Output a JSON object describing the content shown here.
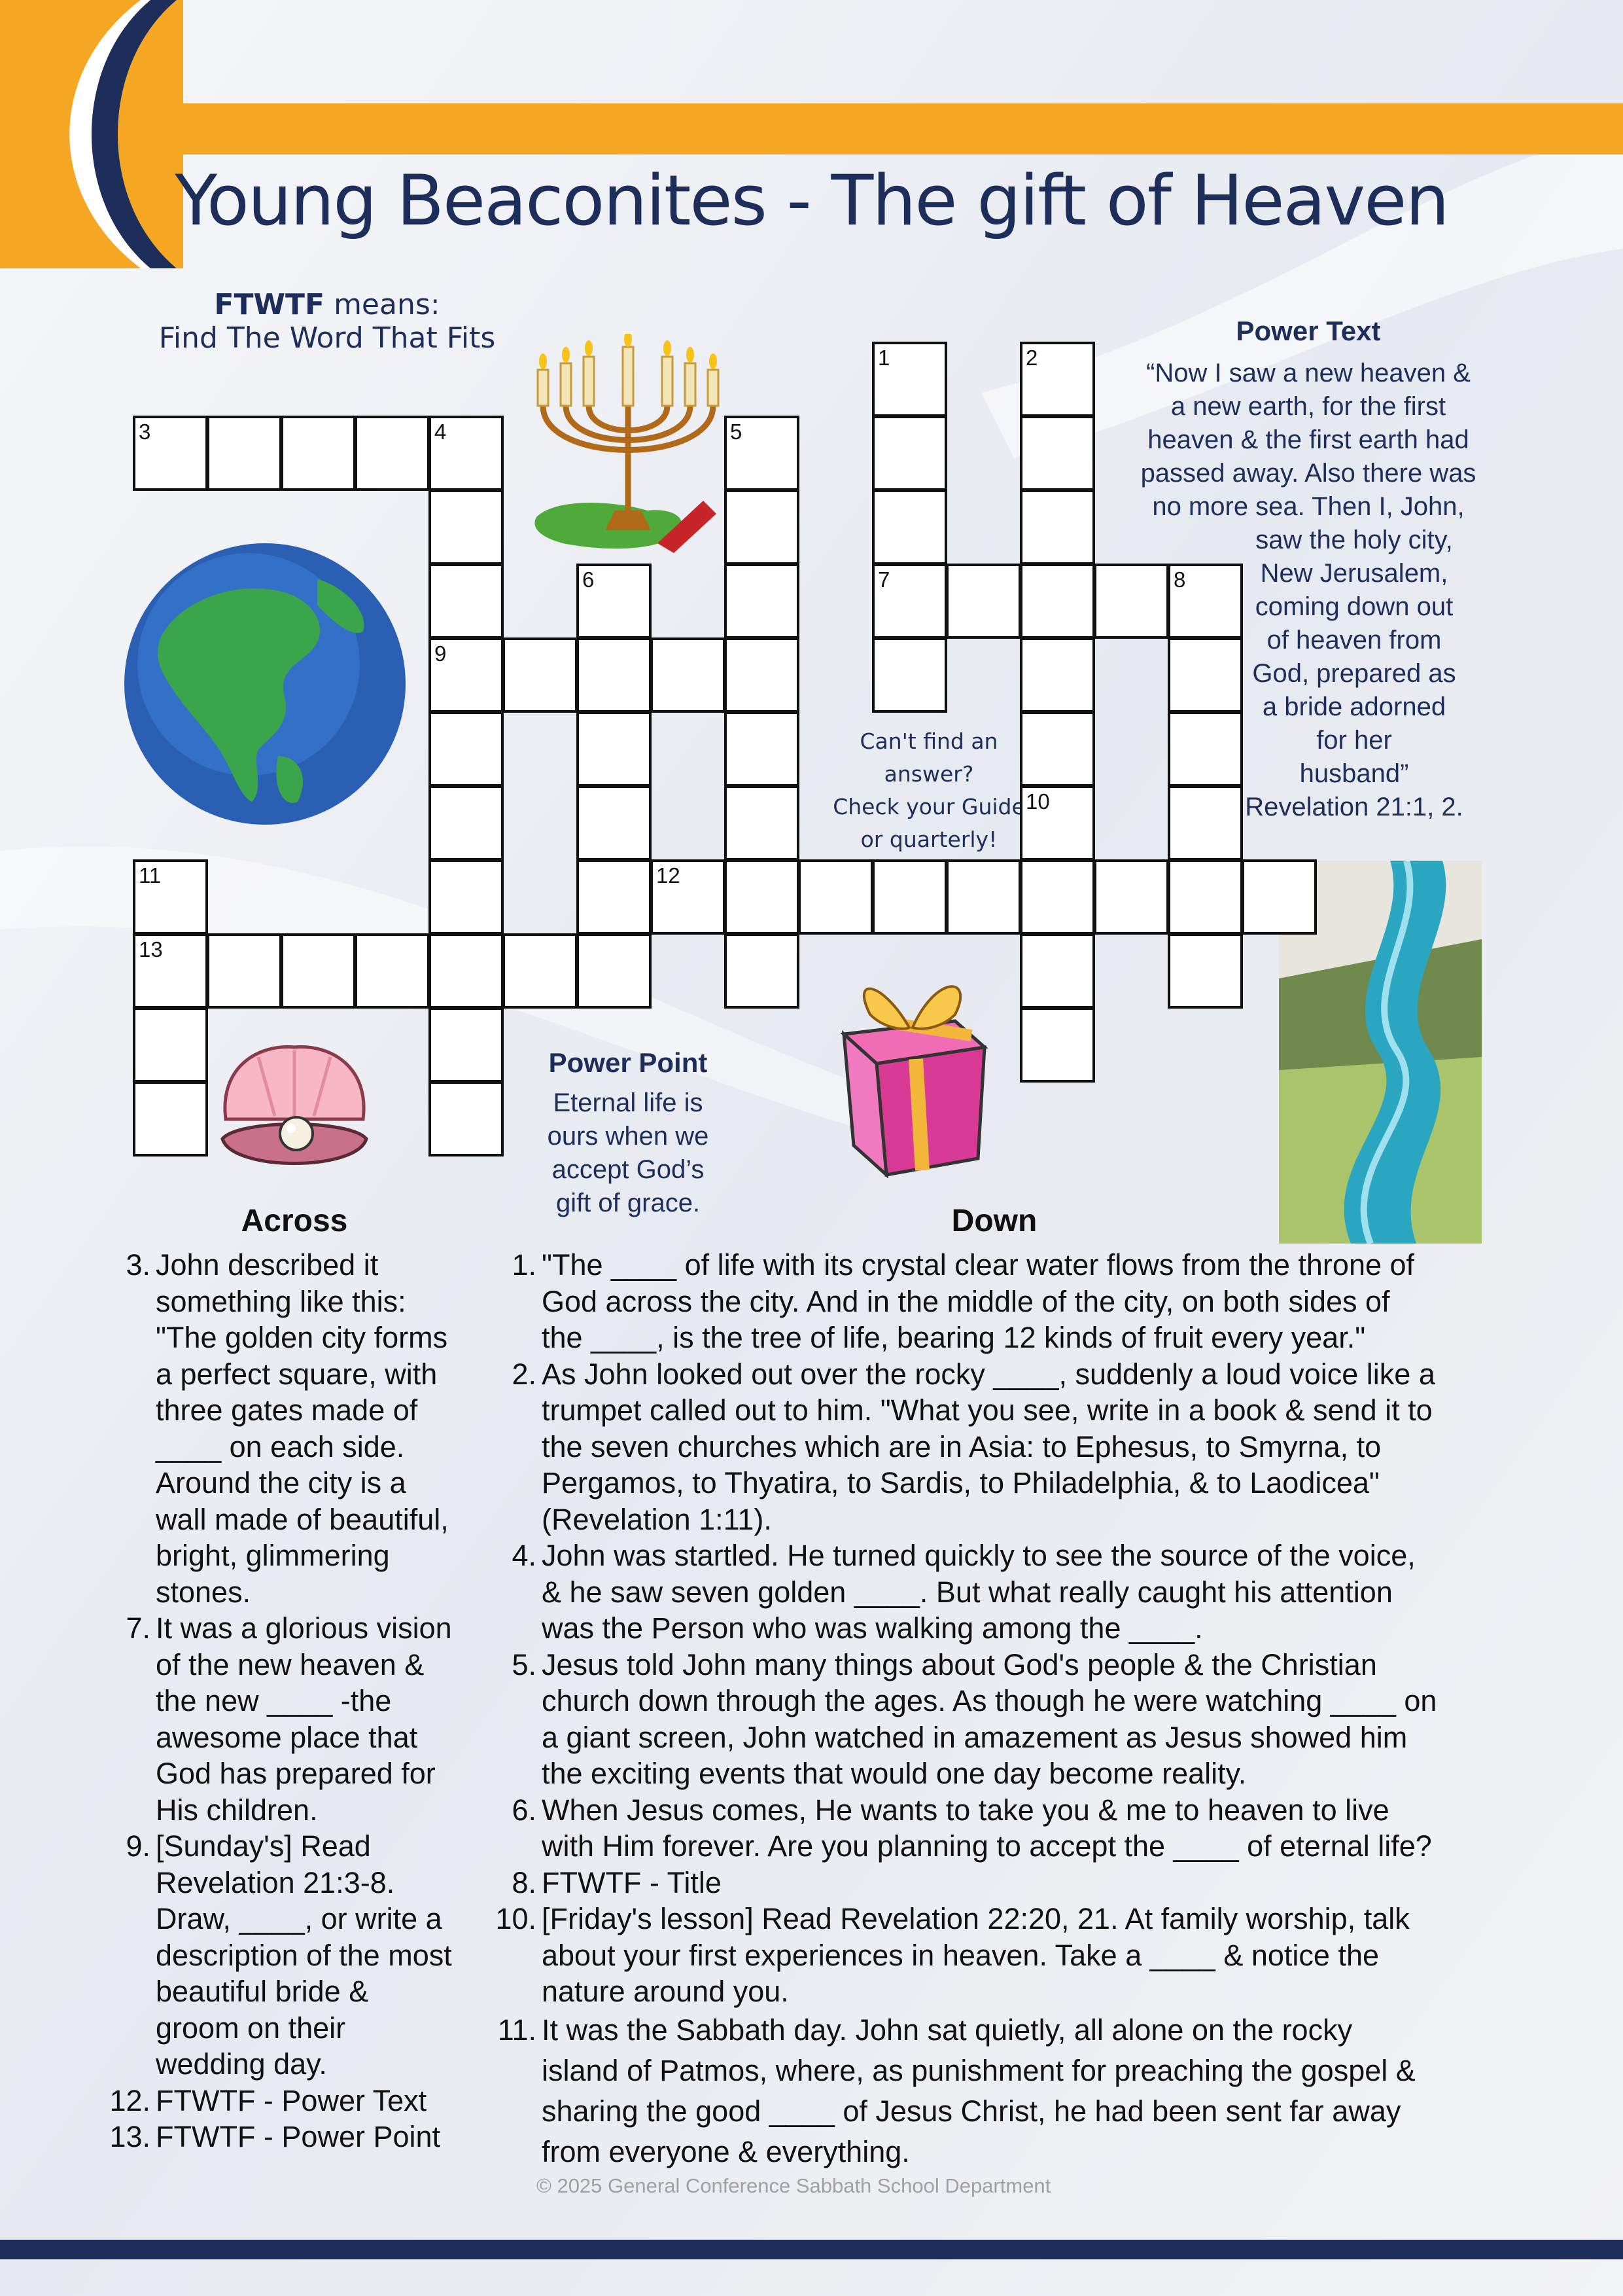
{
  "page": {
    "title": "Young Beaconites - The gift of Heaven",
    "colors": {
      "navy": "#1e2e5a",
      "orange": "#f5a623",
      "bar": "#1e2e5a"
    }
  },
  "ftwtf_note": {
    "bold": "FTWTF",
    "suffix": " means:",
    "line2": "Find The Word That Fits"
  },
  "power_text": {
    "heading": "Power Text",
    "lines": [
      "“Now I saw a new heaven &",
      "a new earth, for the first",
      "heaven & the first earth had",
      "passed away. Also there was",
      "no more sea. Then I, John,",
      "saw the holy city,",
      "New Jerusalem,",
      "coming down out",
      "of heaven from",
      "God, prepared as",
      "a  bride adorned",
      "for  her",
      "husband”",
      "Revelation 21:1, 2."
    ]
  },
  "power_point": {
    "heading": "Power Point",
    "lines": [
      "Eternal life is",
      "ours when we",
      "accept God’s",
      "gift of grace."
    ]
  },
  "help_note": {
    "lines": [
      "Can't find an",
      "answer?",
      "Check your Guide",
      "or quarterly!"
    ]
  },
  "grid": {
    "numbers": [
      "1",
      "2",
      "3",
      "4",
      "5",
      "6",
      "7",
      "8",
      "9",
      "10",
      "11",
      "12",
      "13"
    ]
  },
  "illustrations": [
    "menorah-icon",
    "globe-icon",
    "pearl-shell-icon",
    "gift-box-icon",
    "river-icon"
  ],
  "across": {
    "heading": "Across",
    "clues": [
      {
        "num": "3.",
        "lines": [
          "John described it",
          "something like this:",
          "\"The golden city forms",
          "a perfect square, with",
          "three gates made of",
          "____ on each side.",
          "Around the city is a",
          "wall made of beautiful,",
          "bright, glimmering",
          "stones."
        ]
      },
      {
        "num": "7.",
        "lines": [
          "It was a glorious vision",
          "of the new heaven &",
          "the new ____ -the",
          "awesome place that",
          "God has prepared for",
          "His children."
        ]
      },
      {
        "num": "9.",
        "lines": [
          "[Sunday's] Read",
          "Revelation 21:3-8.",
          "Draw, ____, or write a",
          "description of the most",
          "beautiful bride &",
          "groom on their",
          "wedding day."
        ]
      },
      {
        "num": "12.",
        "lines": [
          "FTWTF - Power Text"
        ]
      },
      {
        "num": "13.",
        "lines": [
          "FTWTF - Power Point"
        ]
      }
    ]
  },
  "down": {
    "heading": "Down",
    "clues": [
      {
        "num": "1.",
        "lines": [
          "\"The ____ of life with its crystal clear water flows from the throne of",
          "God across the city. And in the middle of the city, on both sides of",
          "the ____, is the tree of life, bearing 12 kinds of fruit every year.\""
        ]
      },
      {
        "num": "2.",
        "lines": [
          "As John looked out over the rocky ____, suddenly a loud voice like a",
          "trumpet called out to him. \"What you see, write in a book & send it to",
          "the seven churches which are in Asia: to Ephesus, to Smyrna, to",
          "Pergamos, to Thyatira, to Sardis, to Philadelphia, & to Laodicea\"",
          "(Revelation 1:11)."
        ]
      },
      {
        "num": "4.",
        "lines": [
          "John was startled. He turned quickly to see the source of the voice,",
          "& he saw seven golden ____. But what really caught his attention",
          "was the Person who was walking among the ____."
        ]
      },
      {
        "num": "5.",
        "lines": [
          "Jesus told John many things about God's people & the Christian",
          "church down through the ages. As though he were watching ____ on",
          "a giant screen, John watched in amazement as Jesus showed him",
          "the exciting events that would one day become reality."
        ]
      },
      {
        "num": "6.",
        "lines": [
          "When Jesus comes, He wants to take you & me to heaven to live",
          "with Him forever. Are you planning to accept the ____ of eternal life?"
        ]
      },
      {
        "num": "8.",
        "lines": [
          "FTWTF - Title"
        ]
      },
      {
        "num": "10.",
        "lines": [
          "[Friday's lesson] Read Revelation 22:20, 21. At family worship, talk",
          "about your first experiences in heaven. Take a ____ & notice the",
          "nature around you."
        ]
      },
      {
        "num": "11.",
        "lines": [
          "It was the Sabbath day. John sat quietly, all alone on the rocky",
          "island of Patmos, where, as punishment for preaching the gospel &",
          "sharing the good ____ of Jesus Christ, he had been sent far away",
          "from everyone & everything."
        ]
      }
    ]
  },
  "footer": {
    "copyright": "© 2025 General Conference Sabbath School Department"
  }
}
